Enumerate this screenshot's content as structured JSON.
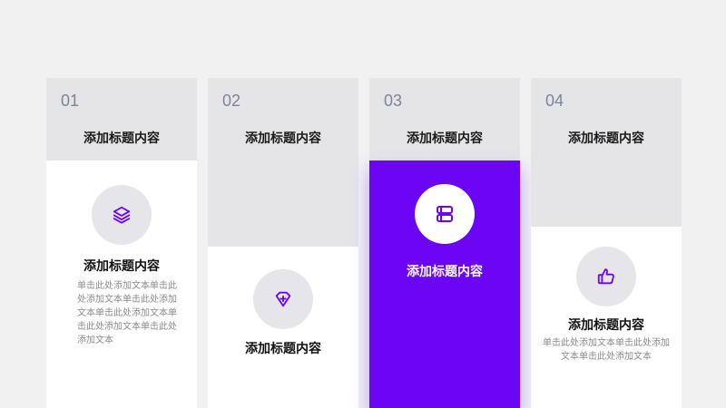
{
  "columns": [
    {
      "number": "01",
      "header": "添加标题内容",
      "icon": "layers-icon",
      "title": "添加标题内容",
      "text": "单击此处添加文本单击此处添加文本单击此处添加文本单击此处添加文本单击此处添加文本单击此处添加文本"
    },
    {
      "number": "02",
      "header": "添加标题内容",
      "icon": "diamond-plus-icon",
      "title": "添加标题内容"
    },
    {
      "number": "03",
      "header": "添加标题内容",
      "icon": "books-icon",
      "title": "添加标题内容"
    },
    {
      "number": "04",
      "header": "添加标题内容",
      "icon": "thumbs-up-icon",
      "title": "添加标题内容",
      "text": "单击此处添加文本单击此处添加文本单击此处添加文本"
    }
  ],
  "colors": {
    "accent": "#6a06f4",
    "gray_panel": "#e5e5e8",
    "background": "#f1f1f2"
  }
}
